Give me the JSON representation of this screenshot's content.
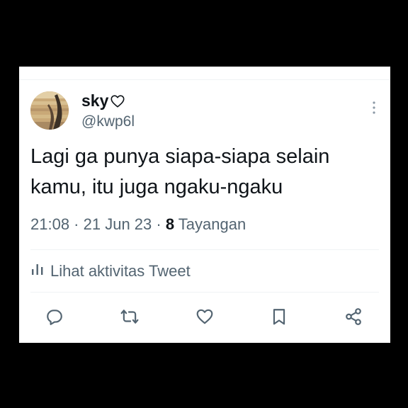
{
  "tweet": {
    "display_name": "sky",
    "name_emoji_icon": "heart-outline-icon",
    "handle": "@kwp6l",
    "text_line1": "Lagi ga punya siapa-siapa selain",
    "text_line2": "kamu, itu juga ngaku-ngaku",
    "time": "21:08",
    "separator1": " · ",
    "date": "21 Jun 23",
    "separator2": " · ",
    "view_count": "8",
    "view_label": "Tayangan",
    "activity_label": "Lihat aktivitas Tweet"
  },
  "actions": [
    {
      "icon": "reply-icon"
    },
    {
      "icon": "retweet-icon"
    },
    {
      "icon": "like-icon"
    },
    {
      "icon": "bookmark-icon"
    },
    {
      "icon": "share-icon"
    }
  ],
  "colors": {
    "text_primary": "#0f1419",
    "text_secondary": "#536471",
    "divider": "#eff3f4",
    "background": "#000000"
  }
}
